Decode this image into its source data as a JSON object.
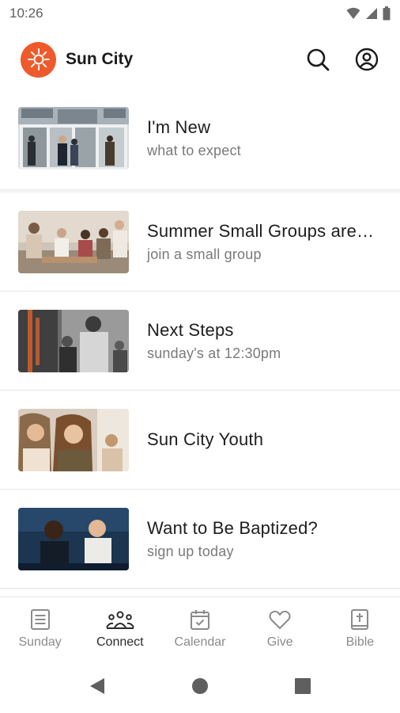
{
  "status_bar": {
    "time": "10:26"
  },
  "header": {
    "title": "Sun City",
    "brand_color": "#ee5a2b"
  },
  "feed": {
    "items": [
      {
        "title": "I'm New",
        "subtitle": "what to expect"
      },
      {
        "title": "Summer Small Groups are…",
        "subtitle": "join a small group"
      },
      {
        "title": "Next Steps",
        "subtitle": "sunday's at 12:30pm"
      },
      {
        "title": "Sun City Youth",
        "subtitle": ""
      },
      {
        "title": "Want to Be Baptized?",
        "subtitle": "sign up today"
      }
    ]
  },
  "bottom_nav": {
    "items": [
      {
        "label": "Sunday",
        "icon": "news-icon"
      },
      {
        "label": "Connect",
        "icon": "people-icon",
        "active": true
      },
      {
        "label": "Calendar",
        "icon": "calendar-icon"
      },
      {
        "label": "Give",
        "icon": "heart-icon"
      },
      {
        "label": "Bible",
        "icon": "bible-icon"
      }
    ]
  }
}
